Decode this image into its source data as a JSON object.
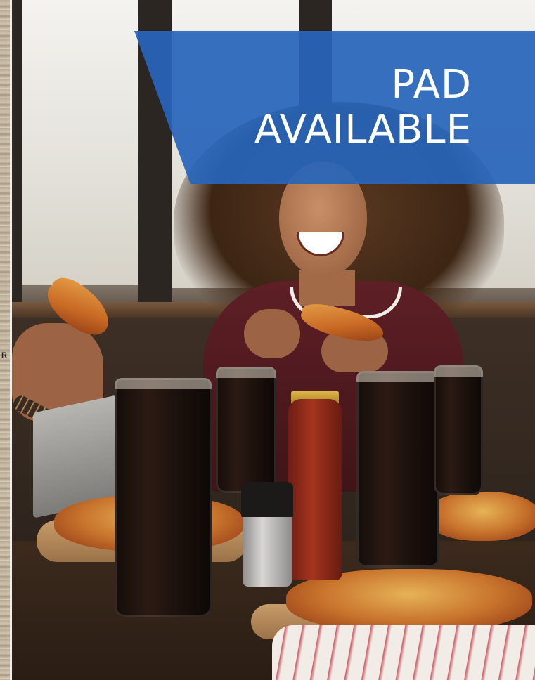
{
  "banner": {
    "line1": "PAD",
    "line2": "AVAILABLE",
    "background_color": "#2865BA",
    "text_color": "#FFFFFF"
  },
  "map_strip": {
    "letter": "R"
  },
  "photo": {
    "scene": "photo"
  }
}
